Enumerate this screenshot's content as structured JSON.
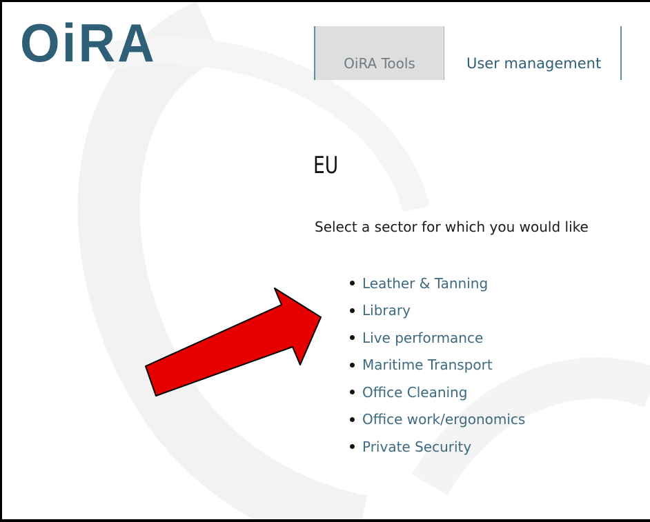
{
  "logo": {
    "text": "OiRA",
    "color": "#2e5f77"
  },
  "tabs": [
    {
      "label": "OiRA Tools",
      "active": true
    },
    {
      "label": "User management",
      "active": false
    }
  ],
  "main": {
    "title": "EU",
    "intro": "Select a sector for which you would like",
    "sectors": [
      "Leather & Tanning",
      "Library",
      "Live performance",
      "Maritime Transport",
      "Office Cleaning",
      "Office work/ergonomics",
      "Private Security"
    ]
  },
  "annotation": {
    "arrow_color": "#e60000"
  }
}
